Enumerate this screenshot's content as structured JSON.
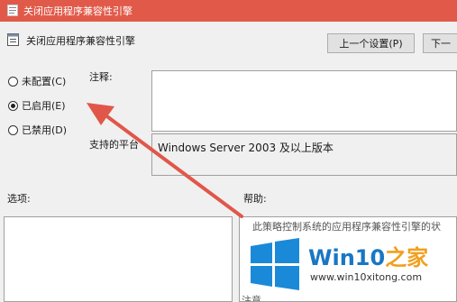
{
  "window": {
    "title": "关闭应用程序兼容性引擎"
  },
  "policy": {
    "name": "关闭应用程序兼容性引擎"
  },
  "buttons": {
    "previous": "上一个设置(P)",
    "next": "下一"
  },
  "radios": [
    {
      "label": "未配置(C)",
      "selected": false
    },
    {
      "label": "已启用(E)",
      "selected": true
    },
    {
      "label": "已禁用(D)",
      "selected": false
    }
  ],
  "labels": {
    "comment": "注释:",
    "supported": "支持的平台",
    "options": "选项:",
    "help": "帮助:"
  },
  "platform": {
    "value": "Windows Server 2003 及以上版本"
  },
  "help": {
    "text": "此策略控制系统的应用程序兼容性引擎的状",
    "text2": "注意"
  },
  "watermark": {
    "brand": "Win10",
    "brand_suffix": "之家",
    "url": "www.win10xitong.com"
  },
  "colors": {
    "titlebar": "#e15a49",
    "arrow": "#e0574a",
    "logo": "#1a8ad8"
  }
}
